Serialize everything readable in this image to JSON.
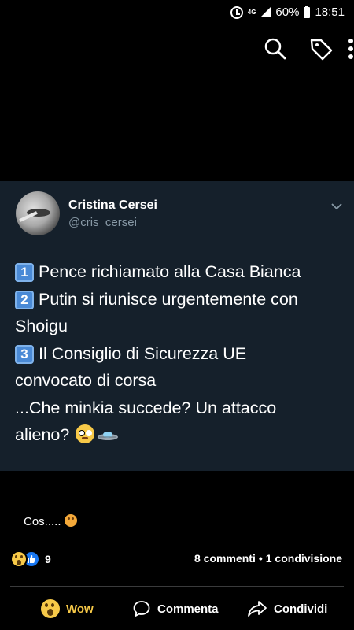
{
  "status_bar": {
    "network": "4G",
    "battery": "60%",
    "time": "18:51",
    "icons": [
      "alarm-icon",
      "signal-icon",
      "battery-icon"
    ]
  },
  "toolbar": {
    "icons": [
      "search-icon",
      "tag-icon",
      "more-vert-icon"
    ]
  },
  "tweet": {
    "author_name": "Cristina Cersei",
    "author_handle": "@cris_cersei",
    "lines": [
      {
        "key": "1",
        "text": "Pence richiamato alla Casa Bianca"
      },
      {
        "key": "2",
        "text": "Putin si riunisce urgentemente con"
      },
      {
        "key": "",
        "text": "Shoigu"
      },
      {
        "key": "3",
        "text": "Il Consiglio di Sicurezza UE"
      },
      {
        "key": "",
        "text": "convocato di corsa"
      },
      {
        "key": "",
        "text": "...Che minkia succede? Un attacco"
      },
      {
        "key": "",
        "text": "alieno?"
      }
    ],
    "emojis": [
      "flushed-face-emoji",
      "ufo-emoji"
    ]
  },
  "post": {
    "comment": "Cos.....",
    "reactions_count": "9",
    "comments": "8 commenti",
    "separator": "•",
    "shares": "1 condivisione"
  },
  "actions": {
    "wow": "Wow",
    "comment": "Commenta",
    "share": "Condividi"
  },
  "colors": {
    "card_bg": "#15202b",
    "handle": "#8899a6",
    "wow": "#f7c948",
    "like": "#1877f2"
  }
}
